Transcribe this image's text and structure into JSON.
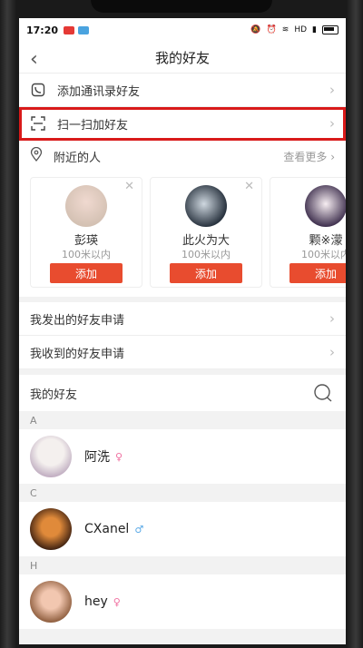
{
  "status": {
    "time": "17:20",
    "network": "HD"
  },
  "nav": {
    "title": "我的好友"
  },
  "menu": {
    "add_contacts": "添加通讯录好友",
    "scan_add": "扫一扫加好友"
  },
  "nearby": {
    "title": "附近的人",
    "more": "查看更多",
    "people": [
      {
        "name": "彭瑛",
        "distance": "100米以内",
        "add": "添加"
      },
      {
        "name": "此火为大",
        "distance": "100米以内",
        "add": "添加"
      },
      {
        "name": "颗※濛",
        "distance": "100米以内",
        "add": "添加"
      }
    ]
  },
  "requests": {
    "sent": "我发出的好友申请",
    "received": "我收到的好友申请"
  },
  "friends": {
    "title": "我的好友",
    "groups": [
      {
        "letter": "A",
        "name": "阿洗",
        "gender": "female",
        "gender_color": "#f06fa0"
      },
      {
        "letter": "C",
        "name": "CXanel",
        "gender": "male",
        "gender_color": "#5aa9e6"
      },
      {
        "letter": "H",
        "name": "hey",
        "gender": "female",
        "gender_color": "#f06fa0"
      }
    ]
  },
  "colors": {
    "accent": "#e84c2f",
    "highlight": "#d91a1a"
  }
}
